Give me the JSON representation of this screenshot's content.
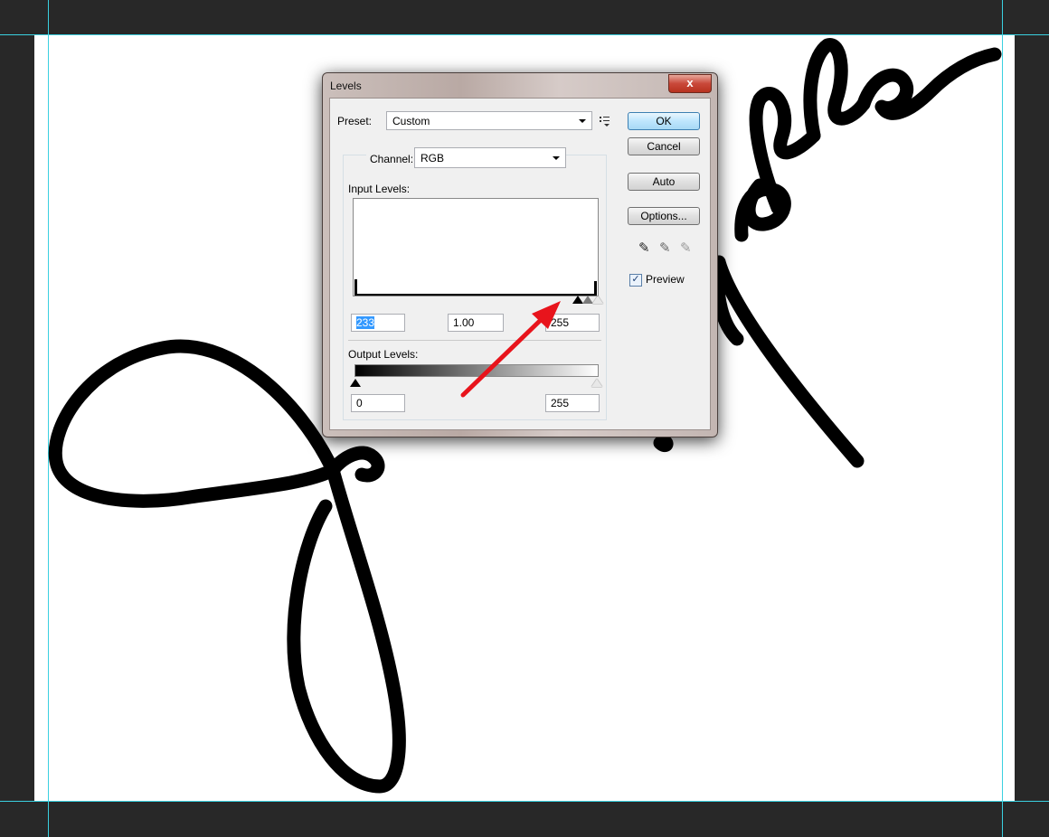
{
  "dialog": {
    "title": "Levels",
    "close_glyph": "x",
    "preset": {
      "label": "Preset:",
      "value": "Custom",
      "menu_icon": "list-menu-icon"
    },
    "channel": {
      "label": "Channel:",
      "value": "RGB"
    },
    "input_levels": {
      "label": "Input Levels:",
      "black": "233",
      "gamma": "1.00",
      "white": "255"
    },
    "output_levels": {
      "label": "Output Levels:",
      "black": "0",
      "white": "255"
    },
    "buttons": {
      "ok": "OK",
      "cancel": "Cancel",
      "auto": "Auto",
      "options": "Options..."
    },
    "droppers": [
      "black-eyedropper-icon",
      "gray-eyedropper-icon",
      "white-eyedropper-icon"
    ],
    "preview": {
      "label": "Preview",
      "checked": true,
      "check_glyph": "✓"
    }
  },
  "colors": {
    "canvas_bg": "#282828",
    "guide": "#3ad0e0",
    "annotation_arrow": "#e8141c",
    "selection": "#3399ff"
  }
}
